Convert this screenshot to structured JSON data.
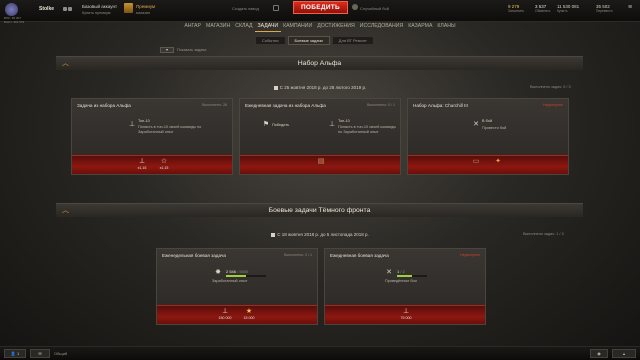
{
  "topbar": {
    "player": "Stolke",
    "stats_lines": [
      "ВЛС: 96 007",
      "Бои/ч: 391 579"
    ],
    "account_title": "Базовый аккаунт",
    "account_sub": "Купить премиум",
    "premium_title": "Премиум",
    "premium_sub": "магазин",
    "platoon_label": "Создать взвод",
    "fight_label": "ПОБЕДИТЬ",
    "mode_label": "Случайный бой",
    "gold_value": "9 279",
    "gold_label": "Заполнить",
    "free_value": "3 537",
    "free_label": "Обменять",
    "credits_value": "11 530 081",
    "credits_label": "Купить",
    "xp_value": "35 502",
    "xp_label": "Перевести"
  },
  "nav": {
    "items": [
      "АНГАР",
      "МАГАЗИН",
      "СКЛАД",
      "ЗАДАЧИ",
      "КАМПАНИИ",
      "ДОСТИЖЕНИЯ",
      "ИССЛЕДОВАНИЯ",
      "КАЗАРМА",
      "КЛАНЫ"
    ],
    "active_index": 3
  },
  "tabs": [
    "События",
    "Боевые задачи",
    "Для ВТ Ремонт"
  ],
  "active_tab": 1,
  "hide_label": "Показать задачи",
  "section1": {
    "title": "Набор Альфа",
    "date": "С 25 жовтня 2018 р. до 28 лютого 2019 р.",
    "count": "Выполнено задач: 0 / 3",
    "cards": [
      {
        "title": "Задача из набора Альфа",
        "right": "Выполнено: 26",
        "condition_icon": "tank-icon",
        "condition_title": "Топ-10",
        "condition_text": "Попасть в топ-10 своей команды по Заработанный опыт",
        "rewards": [
          {
            "icon": "tank-icon",
            "value": "x1,15"
          },
          {
            "icon": "star-icon",
            "value": "x1,15"
          }
        ]
      },
      {
        "title": "Ежедневная задача из набора Альфа",
        "right": "Выполнено: 0 / 1",
        "condition_icon": "flag-icon",
        "condition_title": "Победить",
        "condition2_title": "Топ-10",
        "condition2_text": "Попасть в топ-10 своей команды по Заработанный опыт",
        "rewards": [
          {
            "icon": "pack-icon",
            "value": ""
          }
        ]
      },
      {
        "title": "Набор Альфа: Churchill III",
        "right": "Недоступно",
        "condition_icon": "cross-swords-icon",
        "condition_title": "В бой",
        "condition_text": "Провести бой",
        "rewards": [
          {
            "icon": "tank-reward-icon",
            "value": ""
          }
        ]
      }
    ]
  },
  "section2": {
    "title": "Боевые задачи Тёмного фронта",
    "date": "С 18 жовтня 2018 р. до 5 листопада 2018 р.",
    "count": "Выполнено задач: 1 / 3",
    "cards": [
      {
        "title": "Еженедельная боевая задача",
        "right": "Выполнено: 0 / 1",
        "condition_icon": "explosion-icon",
        "progress_value": "2 546",
        "progress_total": "/ 5000",
        "progress_fraction": 0.51,
        "condition_text": "Заработанный опыт",
        "rewards": [
          {
            "icon": "tank-icon",
            "value": "150 000"
          },
          {
            "icon": "star-icon",
            "value": "15 000"
          }
        ]
      },
      {
        "title": "Ежедневная боевая задача",
        "right": "Недоступно",
        "condition_icon": "cross-swords-icon",
        "progress_value": "1",
        "progress_total": "/ 2",
        "progress_fraction": 0.5,
        "condition_text": "Проведённые бои",
        "rewards": [
          {
            "icon": "tank-icon",
            "value": "75 000"
          }
        ]
      }
    ]
  },
  "bottombar": {
    "left_count": "1",
    "chat_label": "Общий"
  }
}
